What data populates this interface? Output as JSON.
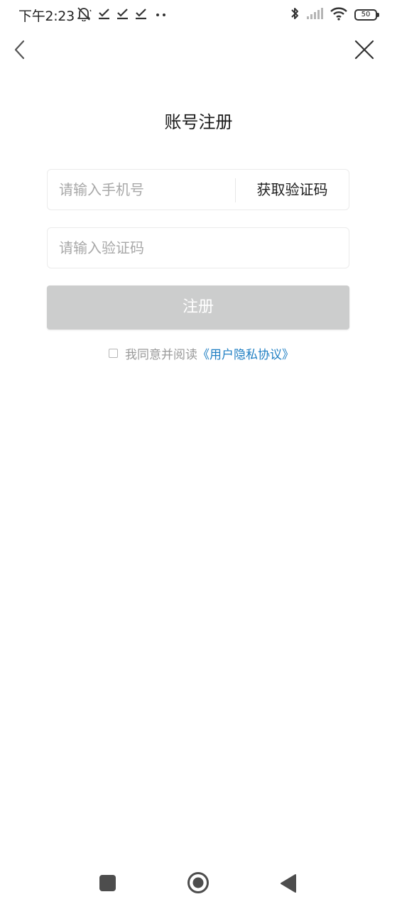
{
  "status_bar": {
    "time": "下午2:23",
    "battery": "50",
    "icons": [
      "mute-bell-icon",
      "check-icon",
      "check-icon",
      "check-icon",
      "more-dots-icon",
      "bluetooth-icon",
      "signal-icon",
      "wifi-icon",
      "battery-icon"
    ]
  },
  "header": {
    "back_icon": "chevron-left-icon",
    "close_icon": "close-icon",
    "title": "账号注册"
  },
  "form": {
    "phone_placeholder": "请输入手机号",
    "get_code_label": "获取验证码",
    "code_placeholder": "请输入验证码",
    "register_label": "注册"
  },
  "agreement": {
    "checked": false,
    "text": "我同意并阅读",
    "link_text": "《用户隐私协议》"
  },
  "system_nav": {
    "icons": [
      "recent-apps-icon",
      "home-icon",
      "back-triangle-icon"
    ]
  },
  "colors": {
    "link": "#1f7fc3",
    "button_disabled": "#cccdcd",
    "placeholder": "#a8a8a8"
  }
}
